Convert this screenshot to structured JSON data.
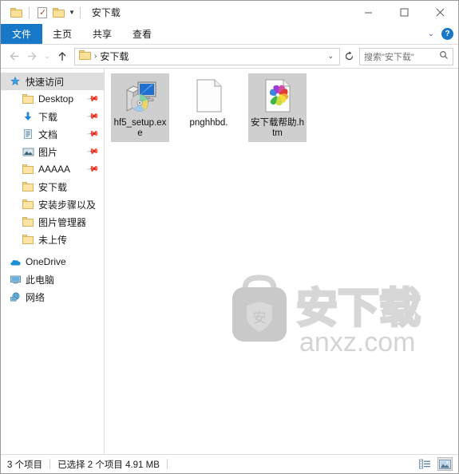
{
  "window": {
    "title": "安下载",
    "quick_access": [
      {
        "name": "folder-icon",
        "label": ""
      },
      {
        "name": "properties-icon",
        "label": ""
      },
      {
        "name": "new-folder-icon",
        "label": ""
      }
    ],
    "controls": {
      "minimize": "minimize-button",
      "maximize": "maximize-button",
      "close": "close-button"
    }
  },
  "ribbon": {
    "tabs": [
      {
        "label": "文件",
        "active": true
      },
      {
        "label": "主页",
        "active": false
      },
      {
        "label": "共享",
        "active": false
      },
      {
        "label": "查看",
        "active": false
      }
    ],
    "collapse_icon": "chevron-down-icon",
    "help_label": "?",
    "accent_color": "#1878c8"
  },
  "navbar": {
    "back_icon": "back-arrow-icon",
    "forward_icon": "forward-arrow-icon",
    "recent_icon": "chevron-down-icon",
    "up_icon": "up-arrow-icon",
    "breadcrumb": {
      "folder_icon": "folder-icon",
      "separator": "›",
      "path": "安下载"
    },
    "address_caret": "chevron-down-icon",
    "refresh_icon": "refresh-icon",
    "search": {
      "placeholder": "搜索\"安下载\"",
      "icon": "search-icon"
    }
  },
  "sidebar": {
    "items": [
      {
        "label": "快速访问",
        "icon": "star-pin-icon",
        "selected": true,
        "pinned": false,
        "indent": false
      },
      {
        "label": "Desktop",
        "icon": "folder-icon",
        "selected": false,
        "pinned": true,
        "indent": true
      },
      {
        "label": "下载",
        "icon": "download-arrow-icon",
        "selected": false,
        "pinned": true,
        "indent": true
      },
      {
        "label": "文档",
        "icon": "documents-icon",
        "selected": false,
        "pinned": true,
        "indent": true
      },
      {
        "label": "图片",
        "icon": "pictures-icon",
        "selected": false,
        "pinned": true,
        "indent": true
      },
      {
        "label": "AAAAA",
        "icon": "folder-icon",
        "selected": false,
        "pinned": true,
        "indent": true
      },
      {
        "label": "安下载",
        "icon": "folder-icon",
        "selected": false,
        "pinned": false,
        "indent": true
      },
      {
        "label": "安装步骤以及",
        "icon": "folder-icon",
        "selected": false,
        "pinned": false,
        "indent": true
      },
      {
        "label": "图片管理器",
        "icon": "folder-icon",
        "selected": false,
        "pinned": false,
        "indent": true
      },
      {
        "label": "未上传",
        "icon": "folder-icon",
        "selected": false,
        "pinned": false,
        "indent": true
      }
    ],
    "roots": [
      {
        "label": "OneDrive",
        "icon": "cloud-icon"
      },
      {
        "label": "此电脑",
        "icon": "computer-icon"
      },
      {
        "label": "网络",
        "icon": "network-icon"
      }
    ]
  },
  "files": [
    {
      "name": "hf5_setup.exe",
      "icon": "installer-icon",
      "selected": true
    },
    {
      "name": "pnghhbd.",
      "icon": "blank-document-icon",
      "selected": false
    },
    {
      "name": "安下载帮助.htm",
      "icon": "html-pinwheel-icon",
      "selected": true
    }
  ],
  "watermark": {
    "logo_char": "安",
    "brand": "安下载",
    "domain": "anxz.com"
  },
  "statusbar": {
    "item_count": "3 个项目",
    "selection": "已选择 2 个项目  4.91 MB",
    "view_buttons": [
      {
        "name": "details-view-button",
        "active": false
      },
      {
        "name": "large-icons-view-button",
        "active": true
      }
    ]
  }
}
